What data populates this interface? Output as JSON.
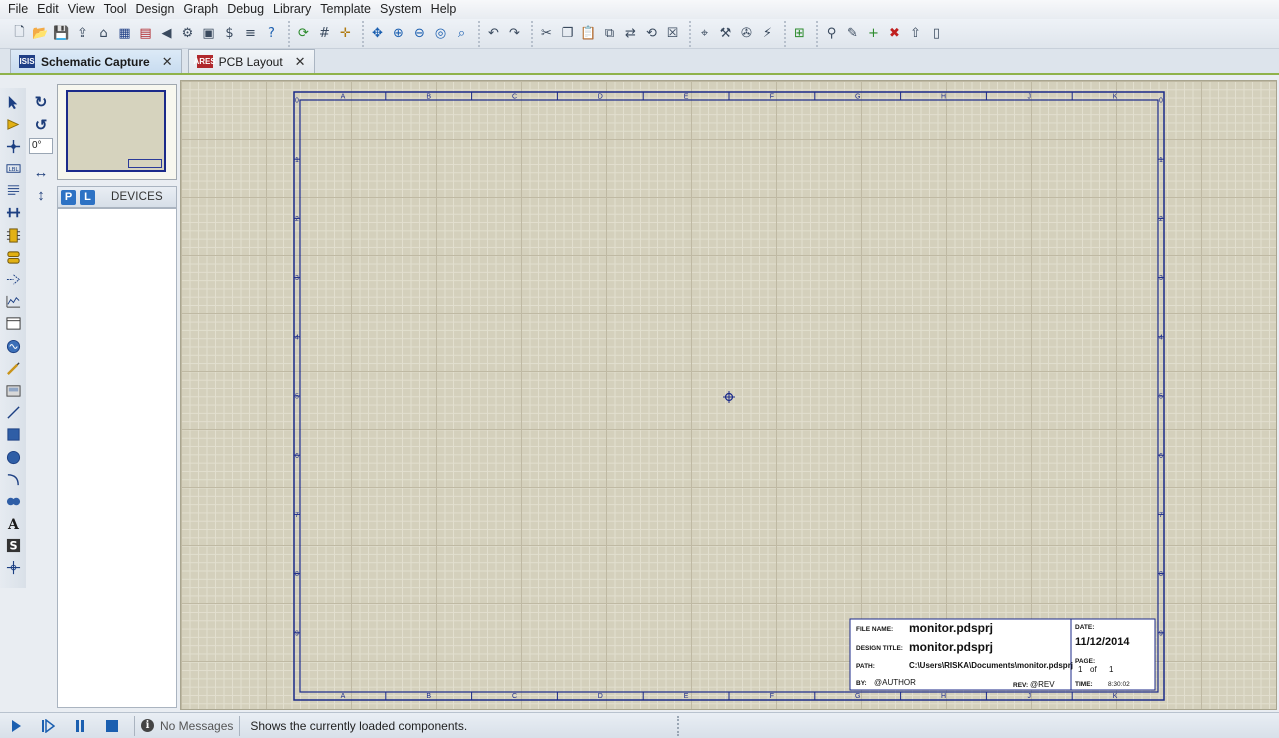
{
  "menu": [
    "File",
    "Edit",
    "View",
    "Tool",
    "Design",
    "Graph",
    "Debug",
    "Library",
    "Template",
    "System",
    "Help"
  ],
  "toolbar": {
    "groups": [
      [
        "new-file-icon",
        "open-folder-icon",
        "save-icon",
        "import-icon",
        "home-icon",
        "isis-icon",
        "ares-icon",
        "back-icon",
        "component-icon",
        "chip-icon",
        "bom-icon",
        "netlist-icon",
        "help-icon"
      ],
      [
        "refresh-icon",
        "grid-icon",
        "origin-icon"
      ],
      [
        "pan-icon",
        "zoom-in-icon",
        "zoom-out-icon",
        "zoom-all-icon",
        "zoom-area-icon"
      ],
      [
        "undo-icon",
        "redo-icon"
      ],
      [
        "cut-icon",
        "copy-icon",
        "paste-icon",
        "block-copy-icon",
        "block-move-icon",
        "block-rotate-icon",
        "block-delete-icon"
      ],
      [
        "pick-device-icon",
        "make-device-icon",
        "package-tool-icon",
        "decompose-icon"
      ],
      [
        "wire-autorouter-icon"
      ],
      [
        "search-icon",
        "property-tool-icon",
        "new-sheet-icon",
        "remove-sheet-icon",
        "exit-parent-icon",
        "report-icon"
      ]
    ]
  },
  "tabs": [
    {
      "label": "Schematic Capture",
      "icon_text": "ISIS",
      "active": true
    },
    {
      "label": "PCB Layout",
      "icon_text": "ARES",
      "active": false
    }
  ],
  "rotation": {
    "value": "0°"
  },
  "devices": {
    "p_label": "P",
    "l_label": "L",
    "title": "DEVICES"
  },
  "sheet": {
    "columns": [
      "A",
      "B",
      "C",
      "D",
      "E",
      "F",
      "G",
      "H",
      "J",
      "K"
    ],
    "rows": [
      "0",
      "1",
      "2",
      "3",
      "4",
      "5",
      "6",
      "7",
      "8",
      "9"
    ],
    "title_block": {
      "file_name_label": "FILE NAME:",
      "file_name": "monitor.pdsprj",
      "design_title_label": "DESIGN TITLE:",
      "design_title": "monitor.pdsprj",
      "path_label": "PATH:",
      "path": "C:\\Users\\RISKA\\Documents\\monitor.pdsprj",
      "by_label": "BY:",
      "by": "@AUTHOR",
      "rev_label": "REV:",
      "rev": "@REV",
      "date_label": "DATE:",
      "date": "11/12/2014",
      "page_label": "PAGE:",
      "page": "1",
      "of_label": "of",
      "of": "1",
      "time_label": "TIME:",
      "time": "8:30:02"
    }
  },
  "status": {
    "messages": "No Messages",
    "text": "Shows the currently loaded components."
  },
  "colors": {
    "sheet_border": "#1b2a8a",
    "canvas_bg": "#d4d0bc",
    "accent": "#8fb24a"
  }
}
